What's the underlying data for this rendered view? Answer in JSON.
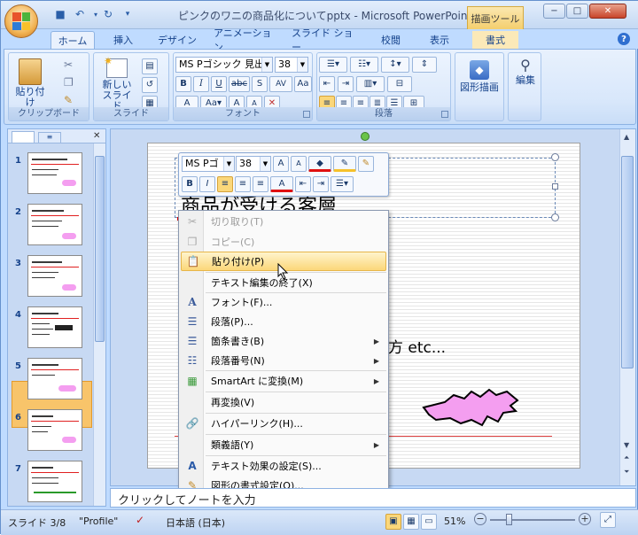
{
  "window": {
    "title": "ピンクのワニの商品化についてpptx - Microsoft PowerPoint",
    "contextual_tab": "描画ツール",
    "controls": {
      "minimize": "−",
      "maximize": "□",
      "close": "✕"
    }
  },
  "tabs": [
    "ホーム",
    "挿入",
    "デザイン",
    "アニメーション",
    "スライド ショー",
    "校閲",
    "表示",
    "書式"
  ],
  "ribbon": {
    "clipboard": {
      "label": "クリップボード",
      "paste": "貼り付け"
    },
    "slides": {
      "label": "スライド",
      "new_slide": "新しい スライド"
    },
    "font": {
      "label": "フォント",
      "name": "MS Pゴシック 見出",
      "size": "38"
    },
    "paragraph": {
      "label": "段落"
    },
    "drawing": {
      "label": "図形描画"
    },
    "editing": {
      "label": "編集"
    }
  },
  "slide_panel": {
    "tabs": [
      "スライド",
      "アウトライン"
    ],
    "slide_numbers": [
      "1",
      "2",
      "3",
      "4",
      "5",
      "6",
      "7"
    ],
    "selected": 3
  },
  "slide": {
    "title_text": "商品が受ける客層",
    "body_text": "方  etc..."
  },
  "mini_toolbar": {
    "font": "MS Pゴ",
    "size": "38"
  },
  "context_menu": [
    {
      "label": "切り取り(T)",
      "icon": "scissors-icon",
      "disabled": true
    },
    {
      "label": "コピー(C)",
      "icon": "copy-icon",
      "disabled": true
    },
    {
      "label": "貼り付け(P)",
      "icon": "paste-icon",
      "highlighted": true
    },
    {
      "label": "テキスト編集の終了(X)",
      "icon": ""
    },
    {
      "label": "フォント(F)...",
      "icon": "font-icon"
    },
    {
      "label": "段落(P)...",
      "icon": "paragraph-icon"
    },
    {
      "label": "箇条書き(B)",
      "icon": "bullets-icon",
      "submenu": true
    },
    {
      "label": "段落番号(N)",
      "icon": "numbering-icon",
      "submenu": true
    },
    {
      "label": "SmartArt に変換(M)",
      "icon": "smartart-icon",
      "submenu": true
    },
    {
      "label": "再変換(V)",
      "icon": ""
    },
    {
      "label": "ハイパーリンク(H)...",
      "icon": "hyperlink-icon"
    },
    {
      "label": "類義語(Y)",
      "icon": "",
      "submenu": true
    },
    {
      "label": "テキスト効果の設定(S)...",
      "icon": "text-effects-icon"
    },
    {
      "label": "図形の書式設定(O)...",
      "icon": "shape-format-icon"
    }
  ],
  "notes": "クリックしてノートを入力",
  "status": {
    "slide": "スライド 3/8",
    "theme": "\"Profile\"",
    "language": "日本語 (日本)",
    "zoom": "51%"
  }
}
